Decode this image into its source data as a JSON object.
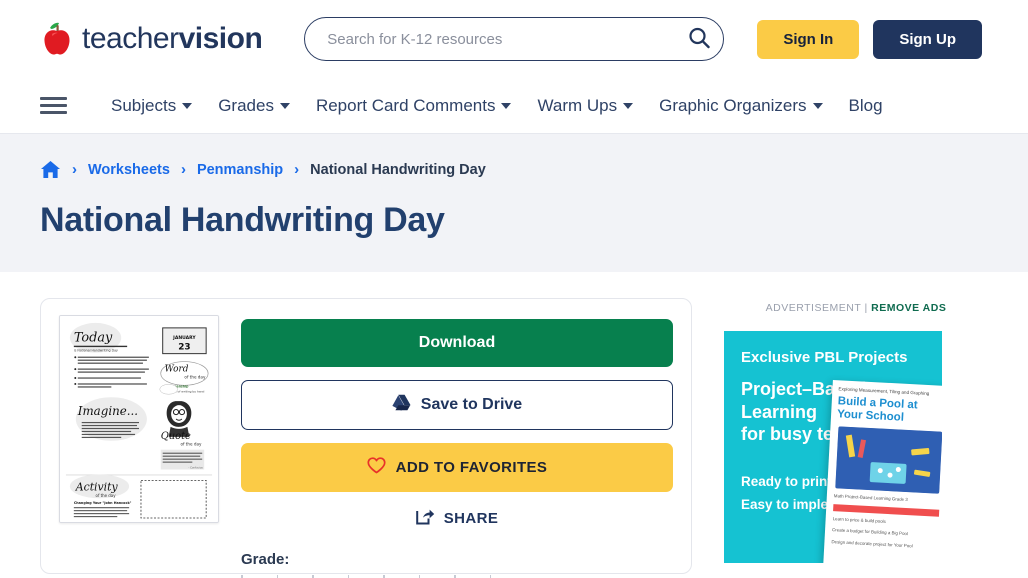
{
  "header": {
    "logo": {
      "light": "teacher",
      "bold": "vision",
      "icon": "apple-icon"
    },
    "search": {
      "placeholder": "Search for K-12 resources",
      "value": "",
      "icon": "search-icon"
    },
    "sign_in": "Sign In",
    "sign_up": "Sign Up",
    "colors": {
      "navy": "#20355e",
      "yellow": "#fbcb46",
      "green": "#07804e",
      "link_blue": "#1a6ae8"
    }
  },
  "nav": {
    "menu_icon": "hamburger-icon",
    "items": [
      {
        "label": "Subjects",
        "has_caret": true
      },
      {
        "label": "Grades",
        "has_caret": true
      },
      {
        "label": "Report Card Comments",
        "has_caret": true
      },
      {
        "label": "Warm Ups",
        "has_caret": true
      },
      {
        "label": "Graphic Organizers",
        "has_caret": true
      },
      {
        "label": "Blog",
        "has_caret": false
      }
    ]
  },
  "hero": {
    "breadcrumb": {
      "home_icon": "home-icon",
      "separator": "›",
      "items": [
        {
          "label": "Worksheets",
          "current": false
        },
        {
          "label": "Penmanship",
          "current": false
        },
        {
          "label": "National Handwriting Day",
          "current": true
        }
      ]
    },
    "title": "National Handwriting Day"
  },
  "main": {
    "thumbnail": {
      "alt": "National Handwriting Day worksheet preview",
      "sections": {
        "today_heading": "Today",
        "today_sub": "is National Handwriting Day",
        "date_month": "JANUARY",
        "date_day": "23",
        "word_heading": "Word",
        "word_sub": "of the day",
        "imagine_heading": "Imagine...",
        "quote_heading": "Quote",
        "quote_sub": "of the day",
        "activity_heading": "Activity",
        "activity_sub": "of the day"
      }
    },
    "buttons": {
      "download": "Download",
      "save_to_drive": "Save to Drive",
      "save_to_drive_icon": "google-drive-icon",
      "add_to_favorites": "ADD TO FAVORITES",
      "favorites_icon": "heart-icon",
      "share": "SHARE",
      "share_icon": "share-icon"
    },
    "grade": {
      "label": "Grade:"
    }
  },
  "ad": {
    "label": "ADVERTISEMENT",
    "divider": "|",
    "remove_ads": "REMOVE ADS",
    "kicker": "Exclusive PBL Projects",
    "title_line1": "Project–Based",
    "title_line2": "Learning",
    "title_line3": "for busy teachers",
    "sub1": "Ready to print.",
    "sub2": "Easy to implement.",
    "book": {
      "top_text": "Exploring Measurement, Tiling and Graphing",
      "title": "Build a Pool at Your School",
      "foot_text": "Math Project-Based Learning Grade 3",
      "bullet1": "Learn to price & build pools",
      "bullet2": "Create a budget for Building a Big Pool",
      "bullet3": "Design and decorate project for Your Pool"
    },
    "bg_color": "#15c2d2"
  }
}
